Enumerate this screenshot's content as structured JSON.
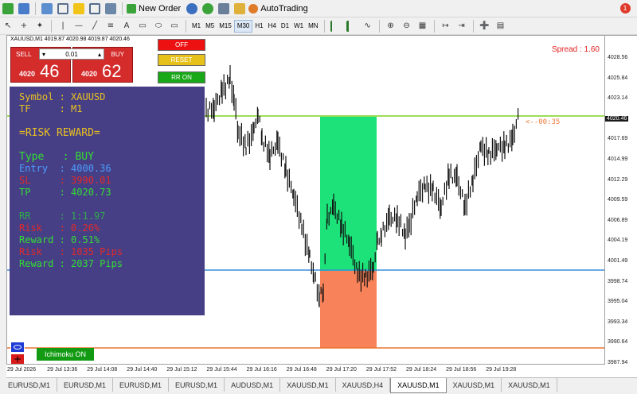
{
  "toolbar": {
    "new_order": "New Order",
    "autotrading": "AutoTrading",
    "notification_count": "1",
    "timeframes": [
      "M1",
      "M5",
      "M15",
      "M30",
      "H1",
      "H4",
      "D1",
      "W1",
      "MN"
    ],
    "selected_timeframe": "M30"
  },
  "chart": {
    "caption": "XAUUSD,M1   4019.87 4020.98 4019.87 4020.46",
    "spread": "Spread : 1.60",
    "timer": "<--00:35",
    "price_labels": [
      "4028.56",
      "4025.84",
      "4023.14",
      "4020.46",
      "4017.69",
      "4014.99",
      "4012.29",
      "4009.59",
      "4006.89",
      "4004.19",
      "4001.49",
      "3998.74",
      "3995.04",
      "3993.34",
      "3990.64",
      "3987.94"
    ],
    "current_price": "4020.46",
    "time_labels": [
      "29 Jul 2026",
      "29 Jul 13:36",
      "29 Jul 14:08",
      "29 Jul 14:40",
      "29 Jul 15:12",
      "29 Jul 15:44",
      "29 Jul 16:16",
      "29 Jul 16:48",
      "29 Jul 17:20",
      "29 Jul 17:52",
      "29 Jul 18:24",
      "29 Jul 18:56",
      "29 Jul 19:28"
    ]
  },
  "trade_panel": {
    "sell_label": "SELL",
    "buy_label": "BUY",
    "lot": "0.01",
    "sell_small": "4020",
    "sell_big": "46",
    "buy_small": "4020",
    "buy_big": "62"
  },
  "controls": {
    "off": "OFF",
    "reset": "RESET",
    "rr_on": "RR ON",
    "ichimoku": "Ichimoku ON"
  },
  "info": {
    "symbol": "Symbol : XAUUSD",
    "tf": "TF     : M1",
    "title": "=RISK REWARD=",
    "type": "Type   : BUY",
    "entry": "Entry  : 4000.36",
    "sl": "SL     : 3990.01",
    "tp": "TP     : 4020.73",
    "rr": "RR     : 1:1.97",
    "risk_pct": "Risk   : 0.26%",
    "reward_pct": "Reward : 0.51%",
    "risk_pips": "Risk   : 1035 Pips",
    "reward_pips": "Reward : 2037 Pips"
  },
  "tabs": [
    "EURUSD,M1",
    "EURUSD,M1",
    "EURUSD,M1",
    "EURUSD,M1",
    "AUDUSD,M1",
    "XAUUSD,M1",
    "XAUUSD,H4",
    "XAUUSD,M1",
    "XAUUSD,M1",
    "XAUUSD,M1"
  ],
  "active_tab_index": 7,
  "colors": {
    "tp_line": "#7ed321",
    "entry_line": "#3a8fd8",
    "sl_line": "#e8742e",
    "tp_zone": "#1de27a",
    "sl_zone": "#f8825a",
    "panel_bg": "#473f86"
  }
}
